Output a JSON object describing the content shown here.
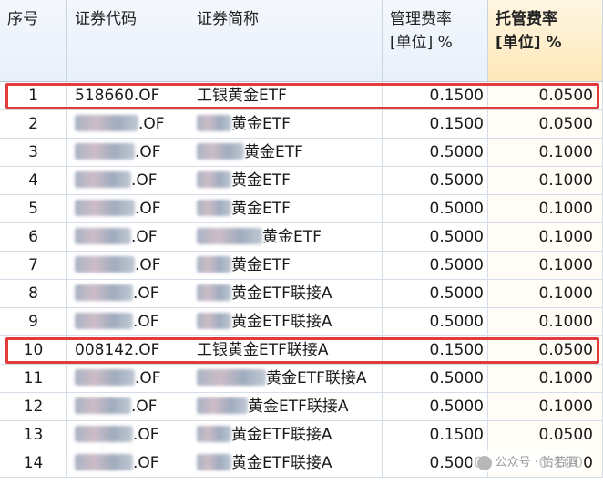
{
  "table": {
    "headers": {
      "index": "序号",
      "code": "证券代码",
      "name": "证券简称",
      "mgmt_fee_line1": "管理费率",
      "mgmt_fee_line2": "[单位] %",
      "custody_fee_line1": "托管费率",
      "custody_fee_line2": "[单位] %"
    },
    "sorted_column": "custody_fee",
    "rows": [
      {
        "index": "1",
        "code_suffix": "518660.OF",
        "name_suffix": "工银黄金ETF",
        "mgmt_fee": "0.1500",
        "custody_fee": "0.0500",
        "highlighted": true
      },
      {
        "index": "2",
        "code_suffix": ".OF",
        "name_suffix": "黄金ETF",
        "mgmt_fee": "0.1500",
        "custody_fee": "0.0500",
        "highlighted": false
      },
      {
        "index": "3",
        "code_suffix": ".OF",
        "name_suffix": "黄金ETF",
        "mgmt_fee": "0.5000",
        "custody_fee": "0.1000",
        "highlighted": false
      },
      {
        "index": "4",
        "code_suffix": ".OF",
        "name_suffix": "黄金ETF",
        "mgmt_fee": "0.5000",
        "custody_fee": "0.1000",
        "highlighted": false
      },
      {
        "index": "5",
        "code_suffix": ".OF",
        "name_suffix": "黄金ETF",
        "mgmt_fee": "0.5000",
        "custody_fee": "0.1000",
        "highlighted": false
      },
      {
        "index": "6",
        "code_suffix": ".OF",
        "name_suffix": "黄金ETF",
        "mgmt_fee": "0.5000",
        "custody_fee": "0.1000",
        "highlighted": false
      },
      {
        "index": "7",
        "code_suffix": ".OF",
        "name_suffix": "黄金ETF",
        "mgmt_fee": "0.5000",
        "custody_fee": "0.1000",
        "highlighted": false
      },
      {
        "index": "8",
        "code_suffix": ".OF",
        "name_suffix": "黄金ETF联接A",
        "mgmt_fee": "0.5000",
        "custody_fee": "0.1000",
        "highlighted": false
      },
      {
        "index": "9",
        "code_suffix": ".OF",
        "name_suffix": "黄金ETF联接A",
        "mgmt_fee": "0.5000",
        "custody_fee": "0.1000",
        "highlighted": false
      },
      {
        "index": "10",
        "code_suffix": "008142.OF",
        "name_suffix": "工银黄金ETF联接A",
        "mgmt_fee": "0.1500",
        "custody_fee": "0.0500",
        "highlighted": true
      },
      {
        "index": "11",
        "code_suffix": ".OF",
        "name_suffix": "黄金ETF联接A",
        "mgmt_fee": "0.5000",
        "custody_fee": "0.1000",
        "highlighted": false
      },
      {
        "index": "12",
        "code_suffix": ".OF",
        "name_suffix": "黄金ETF联接A",
        "mgmt_fee": "0.5000",
        "custody_fee": "0.1000",
        "highlighted": false
      },
      {
        "index": "13",
        "code_suffix": ".OF",
        "name_suffix": "黄金ETF联接A",
        "mgmt_fee": "0.1500",
        "custody_fee": "0.0500",
        "highlighted": false
      },
      {
        "index": "14",
        "code_suffix": ".OF",
        "name_suffix": "黄金ETF联接A",
        "mgmt_fee": "0.5000",
        "custody_fee": "0.1000",
        "highlighted": false
      }
    ]
  },
  "watermark": {
    "text": "公众号 · 怡若酒"
  },
  "colors": {
    "highlight_border": "#e23b3b",
    "header_bg": "#e8f0fa",
    "sorted_header_bg": "#fde7b8",
    "grid_line": "#d4dde8"
  }
}
